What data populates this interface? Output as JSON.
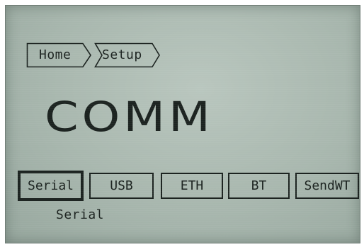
{
  "breadcrumb": {
    "items": [
      {
        "label": "Home"
      },
      {
        "label": "Setup"
      }
    ]
  },
  "page": {
    "title": "COMM"
  },
  "tabs": {
    "items": [
      {
        "label": "Serial"
      },
      {
        "label": "USB"
      },
      {
        "label": "ETH"
      },
      {
        "label": "BT"
      },
      {
        "label": "SendWT"
      }
    ],
    "selected": "Serial"
  },
  "status": {
    "selected_label": "Serial"
  },
  "colors": {
    "lcd_background": "#a8b7ae",
    "ink": "#1c2320"
  }
}
